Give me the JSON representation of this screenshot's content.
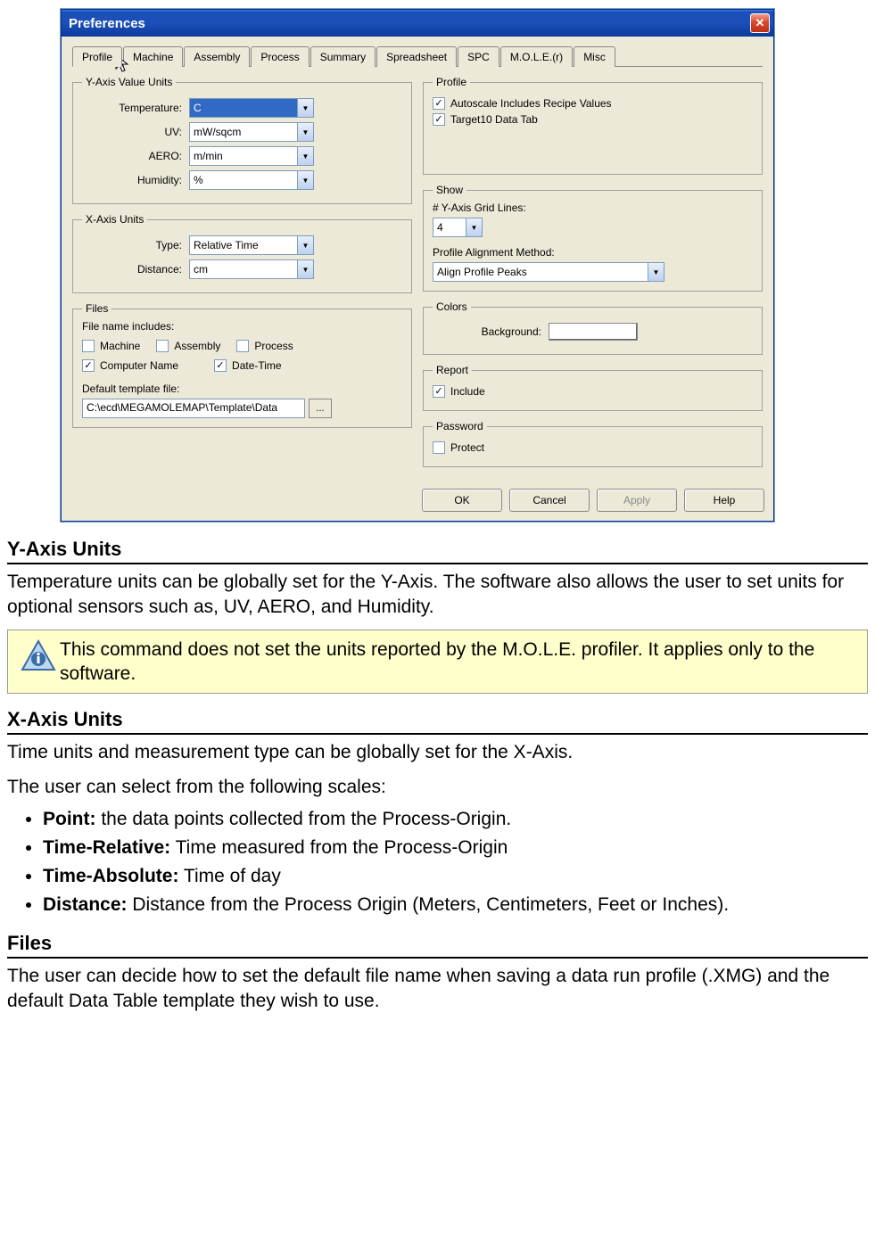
{
  "dialog": {
    "title": "Preferences",
    "tabs": [
      "Profile",
      "Machine",
      "Assembly",
      "Process",
      "Summary",
      "Spreadsheet",
      "SPC",
      "M.O.L.E.(r)",
      "Misc"
    ],
    "yAxisGroup": "Y-Axis Value Units",
    "yAxis": {
      "temperatureLabel": "Temperature:",
      "temperatureValue": "C",
      "uvLabel": "UV:",
      "uvValue": "mW/sqcm",
      "aeroLabel": "AERO:",
      "aeroValue": "m/min",
      "humidityLabel": "Humidity:",
      "humidityValue": "%"
    },
    "xAxisGroup": "X-Axis Units",
    "xAxis": {
      "typeLabel": "Type:",
      "typeValue": "Relative Time",
      "distanceLabel": "Distance:",
      "distanceValue": "cm"
    },
    "filesGroup": "Files",
    "files": {
      "includesLabel": "File name includes:",
      "machine": "Machine",
      "assembly": "Assembly",
      "process": "Process",
      "computerName": "Computer Name",
      "dateTime": "Date-Time",
      "defaultTemplateLabel": "Default template file:",
      "defaultTemplateValue": "C:\\ecd\\MEGAMOLEMAP\\Template\\Data",
      "browse": "..."
    },
    "profileGroup": "Profile",
    "profile": {
      "autoscale": "Autoscale Includes Recipe Values",
      "target10": "Target10 Data Tab"
    },
    "showGroup": "Show",
    "show": {
      "gridLinesLabel": "# Y-Axis Grid Lines:",
      "gridLinesValue": "4",
      "alignLabel": "Profile Alignment Method:",
      "alignValue": "Align Profile Peaks"
    },
    "colorsGroup": "Colors",
    "colors": {
      "backgroundLabel": "Background:"
    },
    "reportGroup": "Report",
    "report": {
      "include": "Include"
    },
    "passwordGroup": "Password",
    "password": {
      "protect": "Protect"
    },
    "buttons": {
      "ok": "OK",
      "cancel": "Cancel",
      "apply": "Apply",
      "help": "Help"
    }
  },
  "doc": {
    "yHeading": "Y-Axis Units",
    "yPara": "Temperature units can be globally set for the Y-Axis. The software also allows the user to set units for optional sensors such as, UV, AERO, and Humidity.",
    "note": "This command does not set the units reported by the M.O.L.E. profiler. It applies only to the software.",
    "xHeading": "X-Axis Units",
    "xPara1": "Time units and measurement type can be globally set for the X-Axis.",
    "xPara2": "The user can select from the following scales:",
    "scales": {
      "pointLabel": "Point:",
      "pointText": " the data points collected from the Process-Origin.",
      "timeRelLabel": "Time-Relative:",
      "timeRelText": " Time measured from the Process-Origin",
      "timeAbsLabel": "Time-Absolute:",
      "timeAbsText": " Time of day",
      "distanceLabel": "Distance:",
      "distanceText": " Distance from the Process Origin (Meters, Centimeters, Feet or Inches)."
    },
    "filesHeading": "Files",
    "filesPara": "The user can decide how to set the default file name when saving a data run profile (.XMG) and the default Data Table template they wish to use."
  }
}
